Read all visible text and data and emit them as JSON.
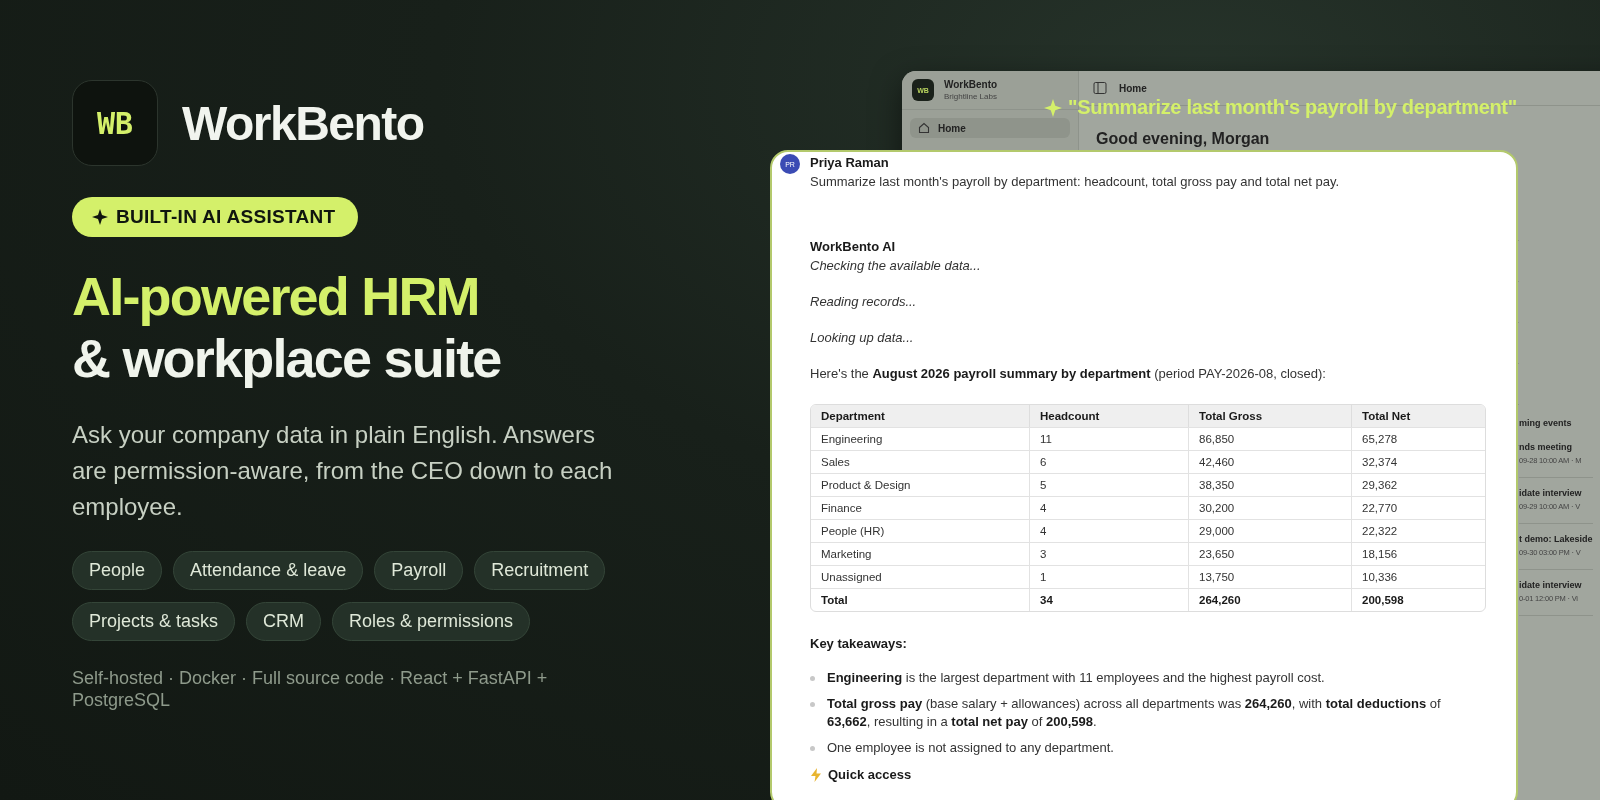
{
  "brand": {
    "logo_text": "WB",
    "name": "WorkBento"
  },
  "badge": {
    "label": "BUILT-IN AI ASSISTANT"
  },
  "headline": {
    "line_1": "AI-powered HRM",
    "line_2": "& workplace suite"
  },
  "description": "Ask your company data in plain English. Answers are permission-aware, from the CEO down to each employee.",
  "tags": [
    "People",
    "Attendance & leave",
    "Payroll",
    "Recruitment",
    "Projects & tasks",
    "CRM",
    "Roles & permissions"
  ],
  "footer": "Self-hosted · Docker · Full source code · React + FastAPI + PostgreSQL",
  "app_window": {
    "workspace_name": "WorkBento",
    "workspace_subtitle": "Brightline Labs",
    "logo_text": "WB",
    "nav_items": [
      {
        "label": "Home",
        "selected": true
      }
    ],
    "breadcrumb": "Home",
    "greeting": "Good evening, Morgan",
    "events_heading": "ming events",
    "events": [
      {
        "title": "nds meeting",
        "meta": "09-28 10:00 AM · M"
      },
      {
        "title": "idate interview",
        "meta": "09-29 10:00 AM · V"
      },
      {
        "title": "t demo: Lakeside",
        "meta": "09-30 03:00 PM · V"
      },
      {
        "title": "idate interview",
        "meta": "0-01 12:00 PM · Vi"
      }
    ]
  },
  "prompt_caption": "\"Summarize last month's payroll by department\"",
  "chat": {
    "user": {
      "initials": "PR",
      "name": "Priya Raman",
      "message": "Summarize last month's payroll by department: headcount, total gross pay and total net pay."
    },
    "assistant": {
      "name": "WorkBento AI",
      "steps": [
        "Checking the available data...",
        "Reading records...",
        "Looking up data..."
      ],
      "intro": "Here's the **August 2026 payroll summary by department** (period PAY-2026-08, closed):",
      "table": {
        "columns": [
          "Department",
          "Headcount",
          "Total Gross",
          "Total Net"
        ],
        "rows": [
          {
            "kind": "data",
            "cells": [
              "Engineering",
              "11",
              "86,850",
              "65,278"
            ]
          },
          {
            "kind": "data",
            "cells": [
              "Sales",
              "6",
              "42,460",
              "32,374"
            ]
          },
          {
            "kind": "data",
            "cells": [
              "Product & Design",
              "5",
              "38,350",
              "29,362"
            ]
          },
          {
            "kind": "data",
            "cells": [
              "Finance",
              "4",
              "30,200",
              "22,770"
            ]
          },
          {
            "kind": "data",
            "cells": [
              "People (HR)",
              "4",
              "29,000",
              "22,322"
            ]
          },
          {
            "kind": "data",
            "cells": [
              "Marketing",
              "3",
              "23,650",
              "18,156"
            ]
          },
          {
            "kind": "data",
            "cells": [
              "Unassigned",
              "1",
              "13,750",
              "10,336"
            ]
          },
          {
            "kind": "total",
            "cells": [
              "Total",
              "34",
              "264,260",
              "200,598"
            ]
          }
        ]
      },
      "takeaways_heading": "Key takeaways:",
      "takeaways": [
        "**Engineering** is the largest department with 11 employees and the highest payroll cost.",
        "**Total gross pay** (base salary + allowances) across all departments was **264,260**, with **total deductions** of **63,662**, resulting in a **total net pay** of **200,598**.",
        "One employee is not assigned to any department."
      ],
      "next_section": "Quick access"
    }
  }
}
